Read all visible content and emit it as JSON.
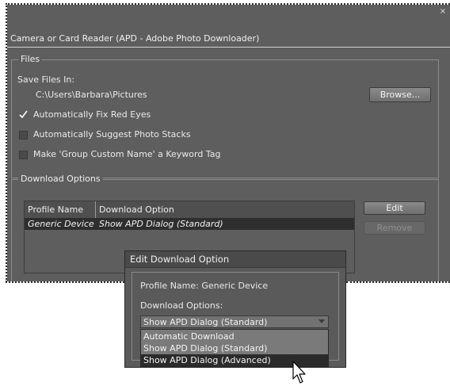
{
  "window": {
    "close_glyph": "×",
    "title": "Camera or Card Reader (APD - Adobe Photo Downloader)"
  },
  "files": {
    "group_label": "Files",
    "save_files_in_label": "Save Files In:",
    "save_path": "C:\\Users\\Barbara\\Pictures",
    "browse_label": "Browse...",
    "options": [
      {
        "label": "Automatically Fix Red Eyes",
        "checked": true
      },
      {
        "label": "Automatically Suggest Photo Stacks",
        "checked": false
      },
      {
        "label": "Make 'Group Custom Name' a Keyword Tag",
        "checked": false
      }
    ]
  },
  "download_options": {
    "group_label": "Download Options",
    "table": {
      "columns": [
        "Profile Name",
        "Download Option"
      ],
      "rows": [
        {
          "profile": "Generic Device",
          "option": "Show APD Dialog (Standard)"
        }
      ]
    },
    "edit_label": "Edit",
    "remove_label": "Remove"
  },
  "edit_dialog": {
    "title": "Edit Download Option",
    "profile_name_text": "Profile Name: Generic Device",
    "download_options_label": "Download Options:",
    "selected_value": "Show APD Dialog (Standard)",
    "dropdown_options": [
      "Automatic Download",
      "Show APD Dialog (Standard)",
      "Show APD Dialog (Advanced)"
    ],
    "highlighted_index": 2
  },
  "icons": {
    "check": "checkmark-icon",
    "dropdown_arrow": "chevron-down-icon",
    "cursor": "mouse-pointer-icon"
  }
}
